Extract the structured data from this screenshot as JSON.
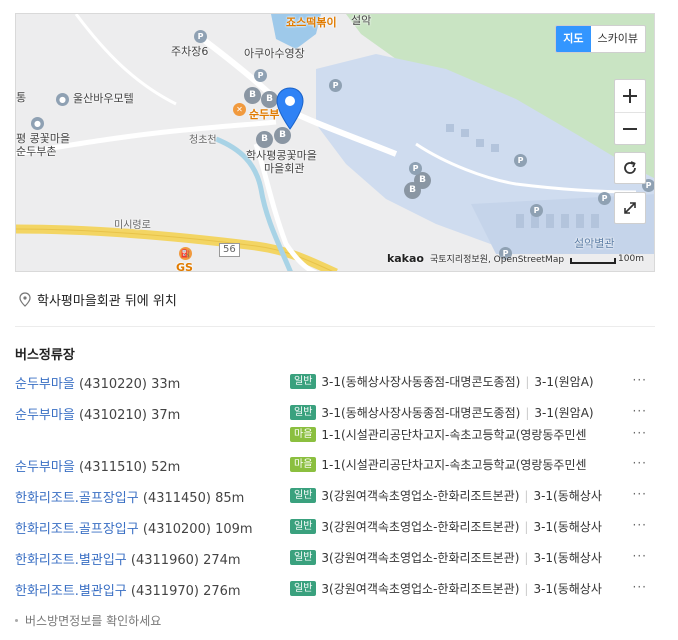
{
  "map": {
    "type_tabs": [
      "지도",
      "스카이뷰"
    ],
    "labels": {
      "tteokbokki": "죠스떡볶이",
      "seorak": "설악",
      "parking6": "주차장6",
      "aqua": "아쿠아수영장",
      "tong": "통",
      "ulsanbawi_motel": "울산바우모텔",
      "sundubu_short": "순두부",
      "kongkkot1": "평 콩꽃마을",
      "kongkkot2": "순두부촌",
      "cheongcho": "청초천",
      "hall1": "학사평콩꽃마을",
      "hall2": "마을회관",
      "misiryeong": "미시령로",
      "road56": "56",
      "gs": "GS",
      "seorak_annex": "설악별관"
    },
    "copyright_brand": "kakao",
    "copyright_text": "국토지리정보원, OpenStreetMap",
    "scale_label": "100m"
  },
  "address": "학사평마을회관 뒤에 위치",
  "bus": {
    "title": "버스정류장",
    "more_label": "···",
    "stops": [
      {
        "name": "순두부마을",
        "id": "(4310220)",
        "dist": "33m",
        "routes": [
          {
            "badge": "일반",
            "kind": "general",
            "text": "3-1(동해상사장사동종점-대명콘도종점)",
            "extra": "3-1(원암A)"
          }
        ]
      },
      {
        "name": "순두부마을",
        "id": "(4310210)",
        "dist": "37m",
        "routes": [
          {
            "badge": "일반",
            "kind": "general",
            "text": "3-1(동해상사장사동종점-대명콘도종점)",
            "extra": "3-1(원암A)"
          },
          {
            "badge": "마을",
            "kind": "village",
            "text": "1-1(시설관리공단차고지-속초고등학교(영랑동주민센",
            "extra": ""
          }
        ]
      },
      {
        "name": "순두부마을",
        "id": "(4311510)",
        "dist": "52m",
        "routes": [
          {
            "badge": "마을",
            "kind": "village",
            "text": "1-1(시설관리공단차고지-속초고등학교(영랑동주민센",
            "extra": ""
          }
        ]
      },
      {
        "name": "한화리조트.골프장입구",
        "id": "(4311450)",
        "dist": "85m",
        "routes": [
          {
            "badge": "일반",
            "kind": "general",
            "text": "3(강원여객속초영업소-한화리조트본관)",
            "extra": "3-1(동해상사"
          }
        ]
      },
      {
        "name": "한화리조트.골프장입구",
        "id": "(4310200)",
        "dist": "109m",
        "routes": [
          {
            "badge": "일반",
            "kind": "general",
            "text": "3(강원여객속초영업소-한화리조트본관)",
            "extra": "3-1(동해상사"
          }
        ]
      },
      {
        "name": "한화리조트.별관입구",
        "id": "(4311960)",
        "dist": "274m",
        "routes": [
          {
            "badge": "일반",
            "kind": "general",
            "text": "3(강원여객속초영업소-한화리조트본관)",
            "extra": "3-1(동해상사"
          }
        ]
      },
      {
        "name": "한화리조트.별관입구",
        "id": "(4311970)",
        "dist": "276m",
        "routes": [
          {
            "badge": "일반",
            "kind": "general",
            "text": "3(강원여객속초영업소-한화리조트본관)",
            "extra": "3-1(동해상사"
          }
        ]
      }
    ],
    "notice": "버스방면정보를 확인하세요"
  }
}
